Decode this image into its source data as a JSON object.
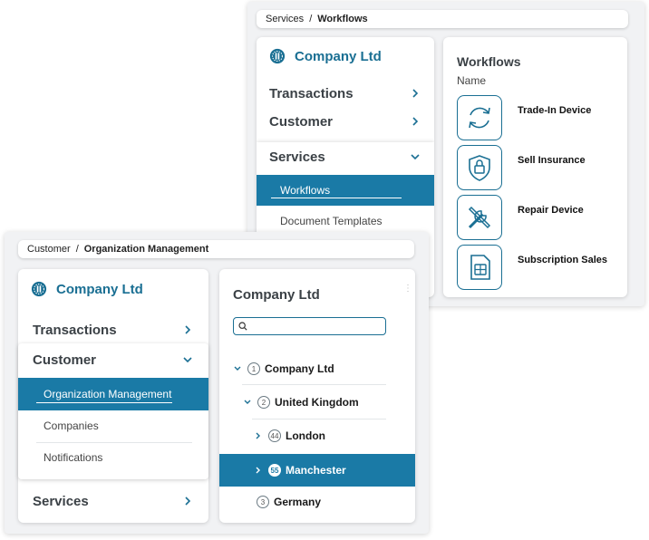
{
  "back_window": {
    "breadcrumb": {
      "parent": "Services",
      "separator": "/",
      "current": "Workflows"
    },
    "brand": {
      "name": "Company Ltd"
    },
    "nav": [
      {
        "label": "Transactions"
      },
      {
        "label": "Customer"
      }
    ],
    "expanded": {
      "label": "Services",
      "items": [
        {
          "label": "Workflows"
        },
        {
          "label": "Document Templates"
        }
      ]
    },
    "workflows": {
      "title": "Workflows",
      "column": "Name",
      "items": [
        {
          "label": "Trade-In Device",
          "icon": "refresh-icon"
        },
        {
          "label": "Sell Insurance",
          "icon": "shield-lock-icon"
        },
        {
          "label": "Repair Device",
          "icon": "tools-icon"
        },
        {
          "label": "Subscription Sales",
          "icon": "sim-card-icon"
        }
      ]
    }
  },
  "front_window": {
    "breadcrumb": {
      "parent": "Customer",
      "separator": "/",
      "current": "Organization Management"
    },
    "brand": {
      "name": "Company Ltd"
    },
    "nav_top": {
      "label": "Transactions"
    },
    "expanded": {
      "label": "Customer",
      "items": [
        {
          "label": "Organization Management"
        },
        {
          "label": "Companies"
        },
        {
          "label": "Notifications"
        }
      ]
    },
    "nav_bottom": {
      "label": "Services"
    },
    "tree": {
      "title": "Company Ltd",
      "search_placeholder": "",
      "nodes": [
        {
          "count": "1",
          "label": "Company Ltd"
        },
        {
          "count": "2",
          "label": "United Kingdom"
        },
        {
          "count": "44",
          "label": "London"
        },
        {
          "count": "55",
          "label": "Manchester"
        },
        {
          "count": "3",
          "label": "Germany"
        }
      ]
    }
  },
  "colors": {
    "accent": "#1a7aa6",
    "brand": "#1a6f93"
  }
}
